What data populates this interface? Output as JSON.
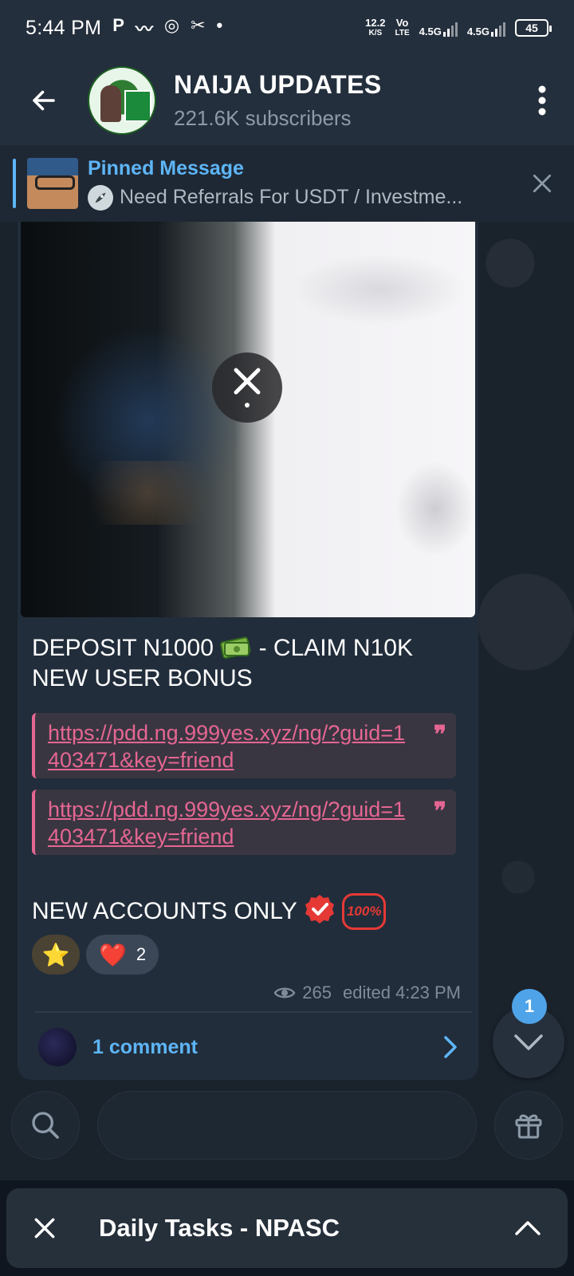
{
  "status_bar": {
    "time": "5:44 PM",
    "app_icons": [
      "P",
      "〰",
      "◎",
      "✂",
      "•"
    ],
    "net_speed_value": "12.2",
    "net_speed_unit": "K/S",
    "volte": "Vo",
    "volte_sub": "LTE",
    "signal1_label": "4.5G",
    "signal2_label": "4.5G",
    "battery": "45"
  },
  "header": {
    "title": "NAIJA UPDATES",
    "subtitle": "221.6K subscribers"
  },
  "pinned": {
    "title": "Pinned Message",
    "preview": "Need Referrals For USDT / Investme..."
  },
  "message": {
    "line1": "DEPOSIT N1000",
    "line1_suffix": " - CLAIM N10K NEW USER BONUS",
    "links": [
      "https://pdd.ng.999yes.xyz/ng/?guid=1403471&key=friend",
      "https://pdd.ng.999yes.xyz/ng/?guid=1403471&key=friend"
    ],
    "quote_mark": "❞",
    "line2": "NEW ACCOUNTS ONLY ",
    "hundred_badge": "100%",
    "reactions": [
      {
        "emoji": "⭐",
        "count": ""
      },
      {
        "emoji": "❤️",
        "count": "2"
      }
    ],
    "views": "265",
    "edited": "edited 4:23 PM",
    "comments_label": "1 comment"
  },
  "fab": {
    "unread_badge": "1"
  },
  "tasks_bar": {
    "title": "Daily Tasks - NPASC"
  },
  "colors": {
    "accent_blue": "#5eb5f7",
    "link_pink": "#e56692",
    "bubble": "#212d3b",
    "header": "#242f3d"
  }
}
